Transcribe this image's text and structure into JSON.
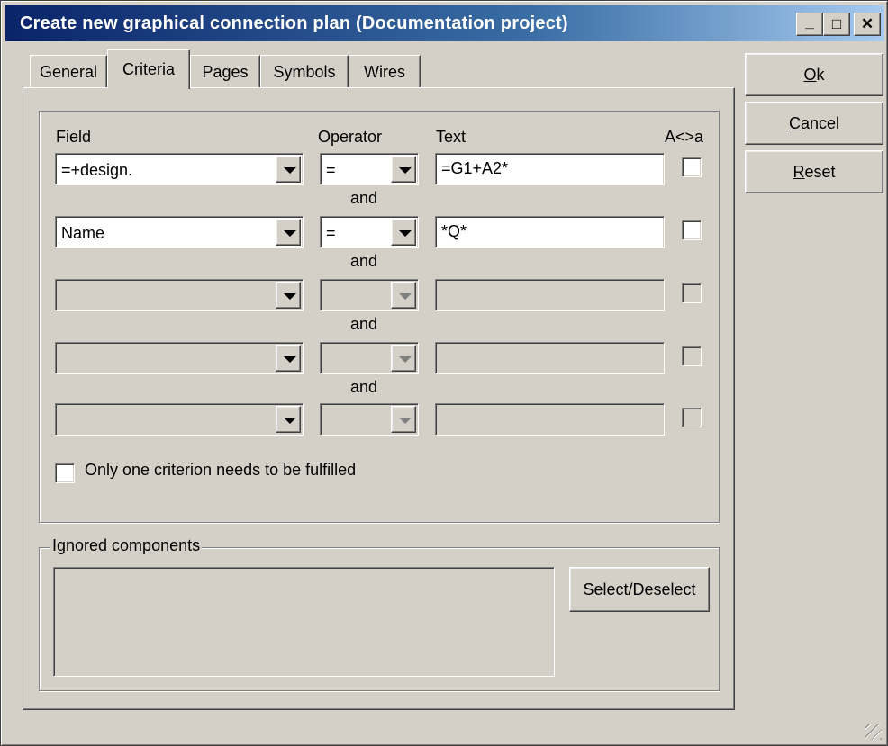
{
  "window": {
    "title": "Create new graphical connection plan (Documentation project)",
    "controls": {
      "minimize": "_",
      "maximize": "□",
      "close": "✕"
    }
  },
  "tabs": [
    {
      "label": "General",
      "active": false
    },
    {
      "label": "Criteria",
      "active": true
    },
    {
      "label": "Pages",
      "active": false
    },
    {
      "label": "Symbols",
      "active": false
    },
    {
      "label": "Wires",
      "active": false
    }
  ],
  "criteria": {
    "headers": {
      "field": "Field",
      "operator": "Operator",
      "text": "Text",
      "case": "A<>a"
    },
    "connector": "and",
    "rows": [
      {
        "field": "=+design.",
        "operator": "=",
        "text": "=G1+A2*",
        "enabled": true
      },
      {
        "field": "Name",
        "operator": "=",
        "text": "*Q*",
        "enabled": true
      },
      {
        "field": "",
        "operator": "",
        "text": "",
        "enabled": false
      },
      {
        "field": "",
        "operator": "",
        "text": "",
        "enabled": false
      },
      {
        "field": "",
        "operator": "",
        "text": "",
        "enabled": false
      }
    ],
    "only_one_label": "Only one criterion needs to be fulfilled"
  },
  "ignored": {
    "legend": "Ignored components",
    "button": "Select/Deselect"
  },
  "buttons": {
    "ok": {
      "mnemonic": "O",
      "rest": "k"
    },
    "cancel": {
      "mnemonic": "C",
      "rest": "ancel"
    },
    "reset": {
      "mnemonic": "R",
      "rest": "eset"
    }
  }
}
